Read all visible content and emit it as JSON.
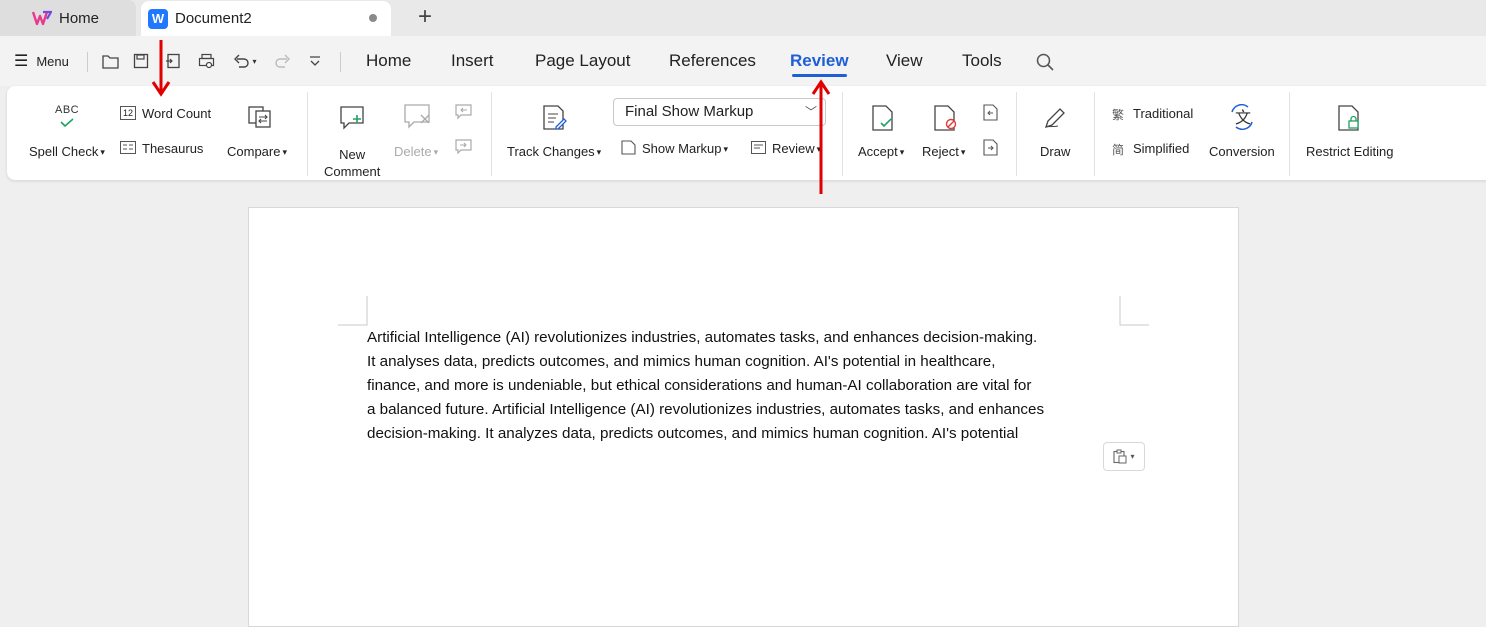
{
  "tabs": {
    "home_label": "Home",
    "doc_label": "Document2",
    "new_tab": "+"
  },
  "menu": {
    "menu_label": "Menu",
    "ribbon_tabs": [
      "Home",
      "Insert",
      "Page Layout",
      "References",
      "Review",
      "View",
      "Tools"
    ],
    "active_tab": "Review"
  },
  "ribbon": {
    "spell_check": "Spell Check",
    "word_count": "Word Count",
    "thesaurus": "Thesaurus",
    "compare": "Compare",
    "new_comment_line1": "New",
    "new_comment_line2": "Comment",
    "delete": "Delete",
    "track_changes": "Track Changes",
    "markup_select": "Final Show Markup",
    "show_markup": "Show Markup",
    "review": "Review",
    "accept": "Accept",
    "reject": "Reject",
    "draw": "Draw",
    "traditional": "Traditional",
    "simplified": "Simplified",
    "conversion": "Conversion",
    "restrict_editing": "Restrict Editing",
    "abc": "ABC",
    "num12": "12"
  },
  "document": {
    "lines": [
      "Artificial Intelligence (AI) revolutionizes industries, automates tasks, and enhances decision-making.",
      "It analyses data, predicts outcomes, and mimics human cognition. AI's potential in healthcare,",
      "finance, and more is undeniable, but ethical considerations and human-AI collaboration are vital for",
      "a balanced future. Artificial Intelligence (AI) revolutionizes industries, automates tasks, and enhances",
      "decision-making. It analyzes data, predicts outcomes, and mimics human cognition. AI's potential"
    ]
  },
  "colors": {
    "accent": "#1f5fd6",
    "annotation_red": "#e00000",
    "doc_icon_blue": "#1f78ff"
  }
}
